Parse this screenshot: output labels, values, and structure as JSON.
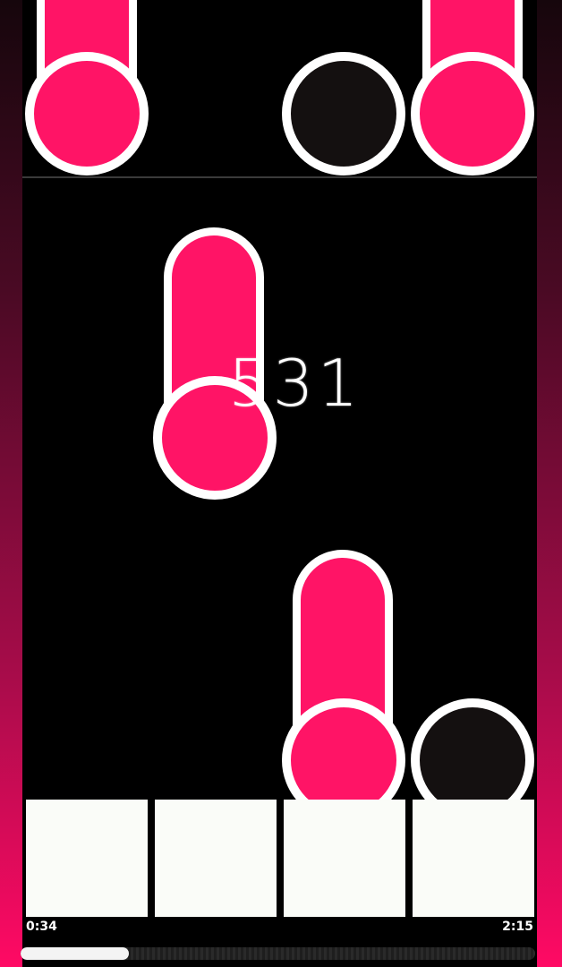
{
  "game": {
    "score": "531",
    "elapsed_time": "0:34",
    "total_time": "2:15",
    "progress": 0.21
  },
  "colors": {
    "tile_pink": "#ff1466",
    "tile_dark": "#141010",
    "tile_border": "#ffffff",
    "key_fill": "#fafcf8",
    "background": "#000000"
  },
  "lanes": [
    {
      "key": "lane-1"
    },
    {
      "key": "lane-2"
    },
    {
      "key": "lane-3"
    },
    {
      "key": "lane-4"
    }
  ]
}
